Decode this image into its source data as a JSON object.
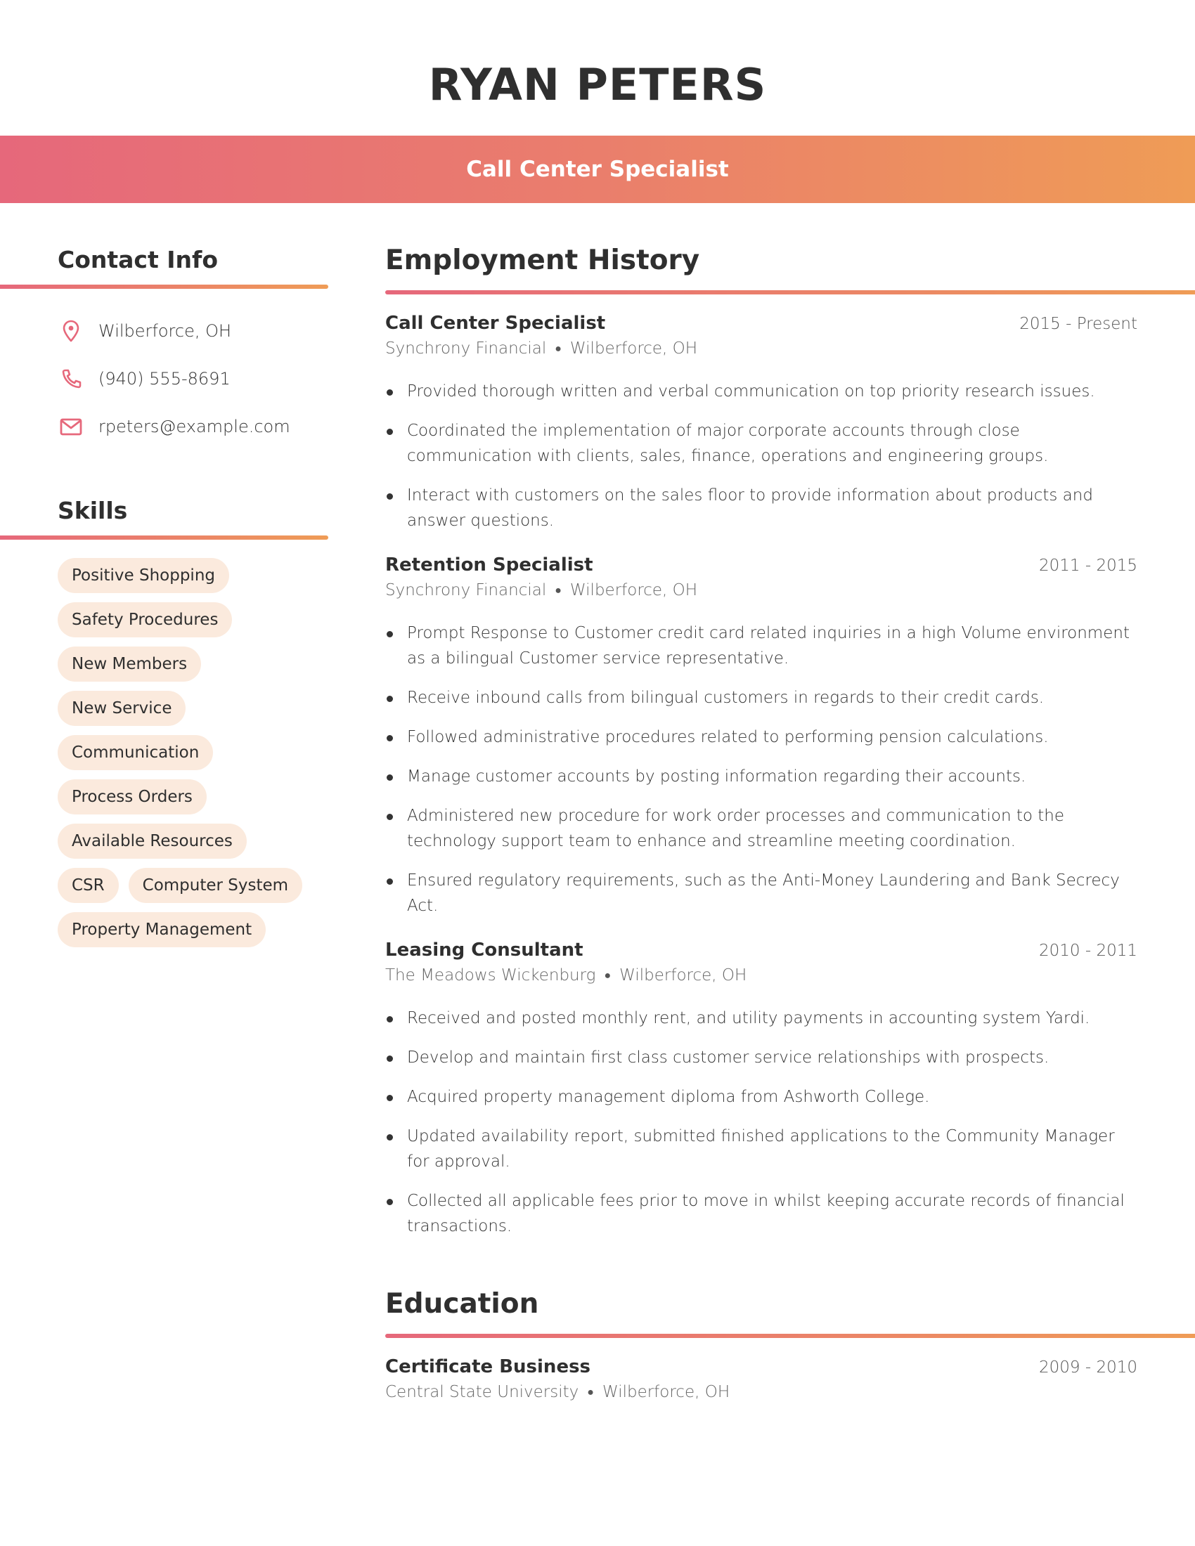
{
  "header": {
    "name": "RYAN PETERS",
    "job_title": "Call Center Specialist"
  },
  "colors": {
    "accent_start": "#e6687b",
    "accent_end": "#ef9c56",
    "chip_background": "#fbeadd",
    "text": "#2f2f2f"
  },
  "contact": {
    "title": "Contact Info",
    "items": [
      {
        "icon": "map-pin-icon",
        "text": "Wilberforce, OH"
      },
      {
        "icon": "phone-icon",
        "text": "(940) 555-8691"
      },
      {
        "icon": "mail-icon",
        "text": "rpeters@example.com"
      }
    ]
  },
  "skills": {
    "title": "Skills",
    "items": [
      "Positive Shopping",
      "Safety Procedures",
      "New Members",
      "New Service",
      "Communication",
      "Process Orders",
      "Available Resources",
      "CSR",
      "Computer System",
      "Property Management"
    ]
  },
  "employment": {
    "title": "Employment History",
    "jobs": [
      {
        "title": "Call Center Specialist",
        "dates": "2015 - Present",
        "company": "Synchrony Financial",
        "location": "Wilberforce, OH",
        "bullets": [
          "Provided thorough written and verbal communication on top priority research issues.",
          "Coordinated the implementation of major corporate accounts through close communication with clients, sales, finance, operations and engineering groups.",
          "Interact with customers on the sales floor to provide information about products and answer questions."
        ]
      },
      {
        "title": "Retention Specialist",
        "dates": "2011 - 2015",
        "company": "Synchrony Financial",
        "location": "Wilberforce, OH",
        "bullets": [
          "Prompt Response to Customer credit card related inquiries in a high Volume environment as a bilingual Customer service representative.",
          "Receive inbound calls from bilingual customers in regards to their credit cards.",
          "Followed administrative procedures related to performing pension calculations.",
          "Manage customer accounts by posting information regarding their accounts.",
          "Administered new procedure for work order processes and communication to the technology support team to enhance and streamline meeting coordination.",
          "Ensured regulatory requirements, such as the Anti-Money Laundering and Bank Secrecy Act."
        ]
      },
      {
        "title": "Leasing Consultant",
        "dates": "2010 - 2011",
        "company": "The Meadows Wickenburg",
        "location": "Wilberforce, OH",
        "bullets": [
          "Received and posted monthly rent, and utility payments in accounting system Yardi.",
          "Develop and maintain first class customer service relationships with prospects.",
          "Acquired property management diploma from Ashworth College.",
          "Updated availability report, submitted finished applications to the Community Manager for approval.",
          "Collected all applicable fees prior to move in whilst keeping accurate records of financial transactions."
        ]
      }
    ]
  },
  "education": {
    "title": "Education",
    "items": [
      {
        "degree": "Certificate Business",
        "dates": "2009 - 2010",
        "school": "Central State University",
        "location": "Wilberforce, OH"
      }
    ]
  }
}
